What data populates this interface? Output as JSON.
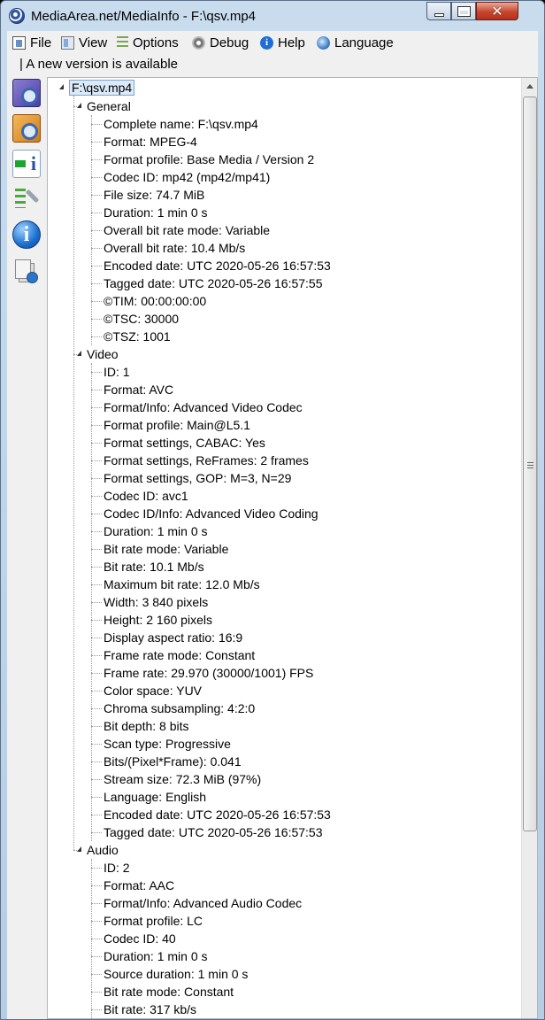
{
  "window": {
    "title": "MediaArea.net/MediaInfo - F:\\qsv.mp4",
    "close_glyph": "✕"
  },
  "menu": [
    {
      "label": "File",
      "icon": "file-icon"
    },
    {
      "label": "View",
      "icon": "view-icon"
    },
    {
      "label": "Options",
      "icon": "options-icon"
    },
    {
      "label": "Debug",
      "icon": "debug-icon"
    },
    {
      "label": "Help",
      "icon": "help-icon"
    },
    {
      "label": "Language",
      "icon": "language-icon"
    }
  ],
  "update_notice": "| A new version is available",
  "sidebar": [
    {
      "name": "basic-view-icon"
    },
    {
      "name": "sheet-view-icon"
    },
    {
      "name": "export-info-icon"
    },
    {
      "name": "preferences-icon"
    },
    {
      "name": "about-icon",
      "glyph": "i"
    },
    {
      "name": "check-update-icon"
    }
  ],
  "tree": {
    "root": "F:\\qsv.mp4",
    "sections": [
      {
        "title": "General",
        "items": [
          "Complete name: F:\\qsv.mp4",
          "Format: MPEG-4",
          "Format profile: Base Media / Version 2",
          "Codec ID: mp42 (mp42/mp41)",
          "File size: 74.7 MiB",
          "Duration: 1 min 0 s",
          "Overall bit rate mode: Variable",
          "Overall bit rate: 10.4 Mb/s",
          "Encoded date: UTC 2020-05-26 16:57:53",
          "Tagged date: UTC 2020-05-26 16:57:55",
          "©TIM: 00:00:00:00",
          "©TSC: 30000",
          "©TSZ: 1001"
        ]
      },
      {
        "title": "Video",
        "items": [
          "ID: 1",
          "Format: AVC",
          "Format/Info: Advanced Video Codec",
          "Format profile: Main@L5.1",
          "Format settings, CABAC: Yes",
          "Format settings, ReFrames: 2 frames",
          "Format settings, GOP: M=3, N=29",
          "Codec ID: avc1",
          "Codec ID/Info: Advanced Video Coding",
          "Duration: 1 min 0 s",
          "Bit rate mode: Variable",
          "Bit rate: 10.1 Mb/s",
          "Maximum bit rate: 12.0 Mb/s",
          "Width: 3 840 pixels",
          "Height: 2 160 pixels",
          "Display aspect ratio: 16:9",
          "Frame rate mode: Constant",
          "Frame rate: 29.970 (30000/1001) FPS",
          "Color space: YUV",
          "Chroma subsampling: 4:2:0",
          "Bit depth: 8 bits",
          "Scan type: Progressive",
          "Bits/(Pixel*Frame): 0.041",
          "Stream size: 72.3 MiB (97%)",
          "Language: English",
          "Encoded date: UTC 2020-05-26 16:57:53",
          "Tagged date: UTC 2020-05-26 16:57:53"
        ]
      },
      {
        "title": "Audio",
        "items": [
          "ID: 2",
          "Format: AAC",
          "Format/Info: Advanced Audio Codec",
          "Format profile: LC",
          "Codec ID: 40",
          "Duration: 1 min 0 s",
          "Source duration: 1 min 0 s",
          "Bit rate mode: Constant",
          "Bit rate: 317 kb/s"
        ]
      }
    ]
  }
}
